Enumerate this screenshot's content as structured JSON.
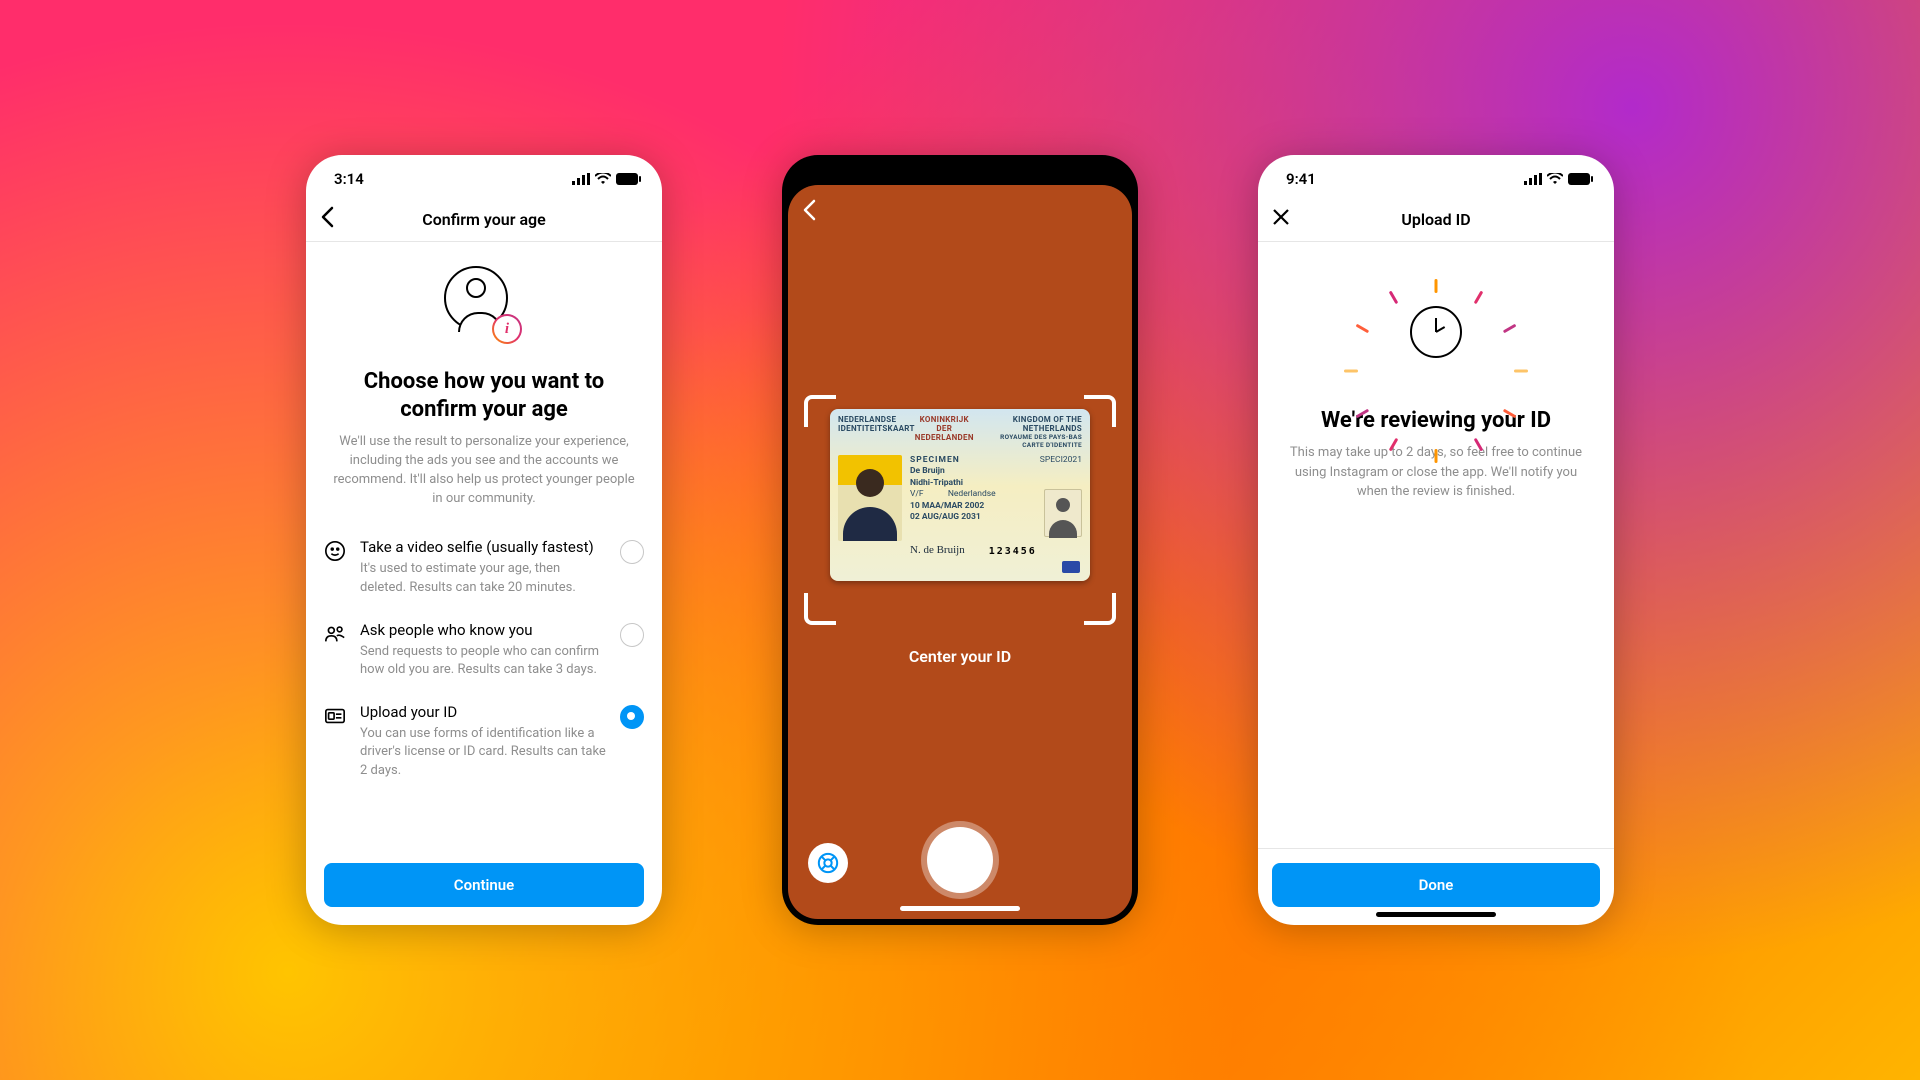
{
  "status": {
    "time_a": "3:14",
    "time_b": "9:41",
    "time_c": "9:41"
  },
  "screen1": {
    "nav_title": "Confirm your age",
    "heading": "Choose how you want to confirm your age",
    "subtext": "We'll use the result to personalize your experience, including the ads you see and the accounts we recommend. It'll also help us protect younger people in our community.",
    "options": [
      {
        "title": "Take a video selfie (usually fastest)",
        "desc": "It's used to estimate your age, then deleted. Results can take 20 minutes.",
        "selected": false
      },
      {
        "title": "Ask people who know you",
        "desc": "Send requests to people who can confirm how old you are. Results can take 3 days.",
        "selected": false
      },
      {
        "title": "Upload your ID",
        "desc": "You can use forms of identification like a driver's license or ID card. Results can take 2 days.",
        "selected": true
      }
    ],
    "continue_label": "Continue"
  },
  "screen2": {
    "instruction": "Center your ID",
    "id_card": {
      "top_left_1": "NEDERLANDSE",
      "top_left_2": "IDENTITEITSKAART",
      "top_mid": "KONINKRIJK DER NEDERLANDEN",
      "top_right_1": "KINGDOM OF THE NETHERLANDS",
      "top_right_2": "ROYAUME DES PAYS-BAS",
      "top_right_3": "CARTE D'IDENTITE",
      "surname": "De Bruijn",
      "given": "Nidhi-Tripathi",
      "sex": "V/F",
      "nationality": "Nederlandse",
      "dob": "10 MAA/MAR 2002",
      "expiry": "02 AUG/AUG 2031",
      "doc_type": "SPECIMEN",
      "doc_code": "SPECI2021",
      "number": "123456",
      "signature": "N. de Bruijn"
    }
  },
  "screen3": {
    "nav_title": "Upload ID",
    "heading": "We're reviewing your ID",
    "subtext": "This may take up to 2 days, so feel free to continue using Instagram or close the app. We'll notify you when the review is finished.",
    "done_label": "Done"
  }
}
